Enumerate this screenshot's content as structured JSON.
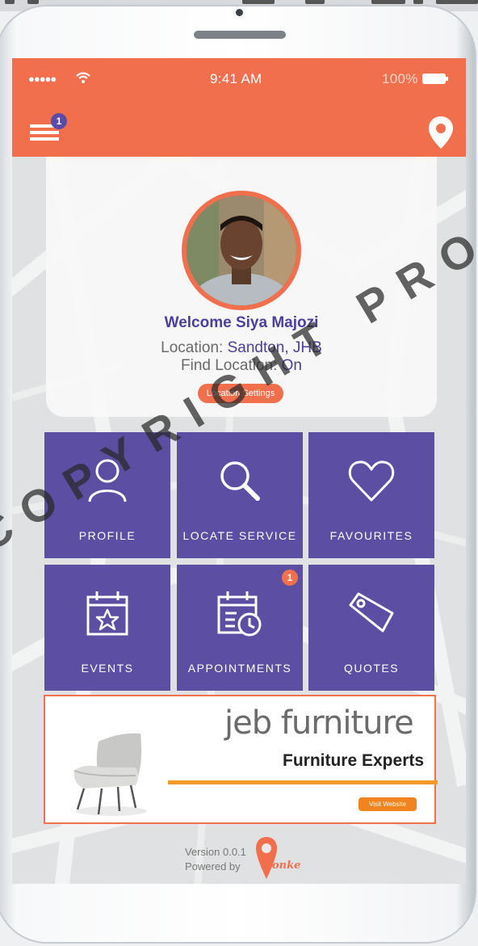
{
  "status_bar": {
    "signal": "●●●●●",
    "time": "9:41 AM",
    "battery": "100%"
  },
  "header": {
    "menu_badge": "1"
  },
  "profile": {
    "welcome": "Welcome Siya Majozi",
    "location_label": "Location:",
    "location_value": "Sandton, JHB",
    "find_location_label": "Find Location:",
    "find_location_value": "On",
    "settings_button": "Location Settings"
  },
  "tiles": [
    {
      "label": "PROFILE",
      "icon": "user-icon"
    },
    {
      "label": "LOCATE SERVICE",
      "icon": "search-icon"
    },
    {
      "label": "FAVOURITES",
      "icon": "heart-icon"
    },
    {
      "label": "EVENTS",
      "icon": "calendar-star-icon"
    },
    {
      "label": "APPOINTMENTS",
      "icon": "calendar-clock-icon",
      "badge": "1"
    },
    {
      "label": "QUOTES",
      "icon": "tag-icon"
    }
  ],
  "ad": {
    "brand": "jeb furniture",
    "tagline": "Furniture Experts",
    "button": "Visit Website"
  },
  "footer": {
    "version": "Version 0.0.1",
    "powered_by": "Powered by",
    "logo_text": "onke"
  },
  "watermark": "COPYRIGHT PROTECT",
  "colors": {
    "header": "#f26f4e",
    "tile": "#5b4ea3",
    "accent_text": "#4a3f9a"
  }
}
